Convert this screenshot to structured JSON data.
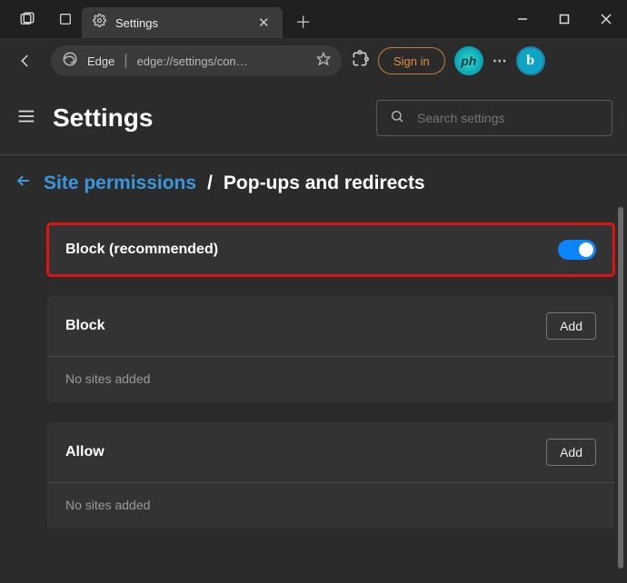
{
  "titlebar": {
    "tab_title": "Settings",
    "gear_icon": "gear-icon"
  },
  "addressbar": {
    "product": "Edge",
    "url": "edge://settings/con…",
    "signin": "Sign in"
  },
  "header": {
    "title": "Settings",
    "search_placeholder": "Search settings"
  },
  "breadcrumb": {
    "parent": "Site permissions",
    "sep": "/",
    "current": "Pop-ups and redirects"
  },
  "block_toggle": {
    "label": "Block (recommended)",
    "on": true
  },
  "sections": {
    "block": {
      "title": "Block",
      "add": "Add",
      "empty": "No sites added"
    },
    "allow": {
      "title": "Allow",
      "add": "Add",
      "empty": "No sites added"
    }
  }
}
